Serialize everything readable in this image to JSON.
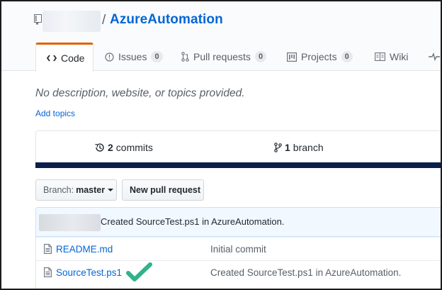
{
  "repo": {
    "separator": "/",
    "name": "AzureAutomation"
  },
  "tabs": [
    {
      "label": "Code"
    },
    {
      "label": "Issues",
      "count": "0"
    },
    {
      "label": "Pull requests",
      "count": "0"
    },
    {
      "label": "Projects",
      "count": "0"
    },
    {
      "label": "Wiki"
    }
  ],
  "about": {
    "description": "No description, website, or topics provided.",
    "add_topics": "Add topics"
  },
  "summary": {
    "commits_count": "2",
    "commits_label": "commits",
    "branch_count": "1",
    "branch_label": "branch"
  },
  "toolbar": {
    "branch_prefix": "Branch:",
    "branch_name": "master",
    "new_pr": "New pull request"
  },
  "latest_commit": {
    "message": "Created SourceTest.ps1 in AzureAutomation."
  },
  "files": [
    {
      "name": "README.md",
      "message": "Initial commit"
    },
    {
      "name": "SourceTest.ps1",
      "message": "Created SourceTest.ps1 in AzureAutomation."
    }
  ],
  "colors": {
    "link": "#0366d6",
    "selected_tab_accent": "#e36209",
    "checkmark": "#2fb38a",
    "summary_bar": "#0b1f4b"
  },
  "icons": [
    "repo-icon",
    "code-icon",
    "issue-icon",
    "pull-request-icon",
    "project-icon",
    "wiki-icon",
    "pulse-icon",
    "history-icon",
    "branch-icon",
    "file-icon",
    "checkmark-icon"
  ]
}
